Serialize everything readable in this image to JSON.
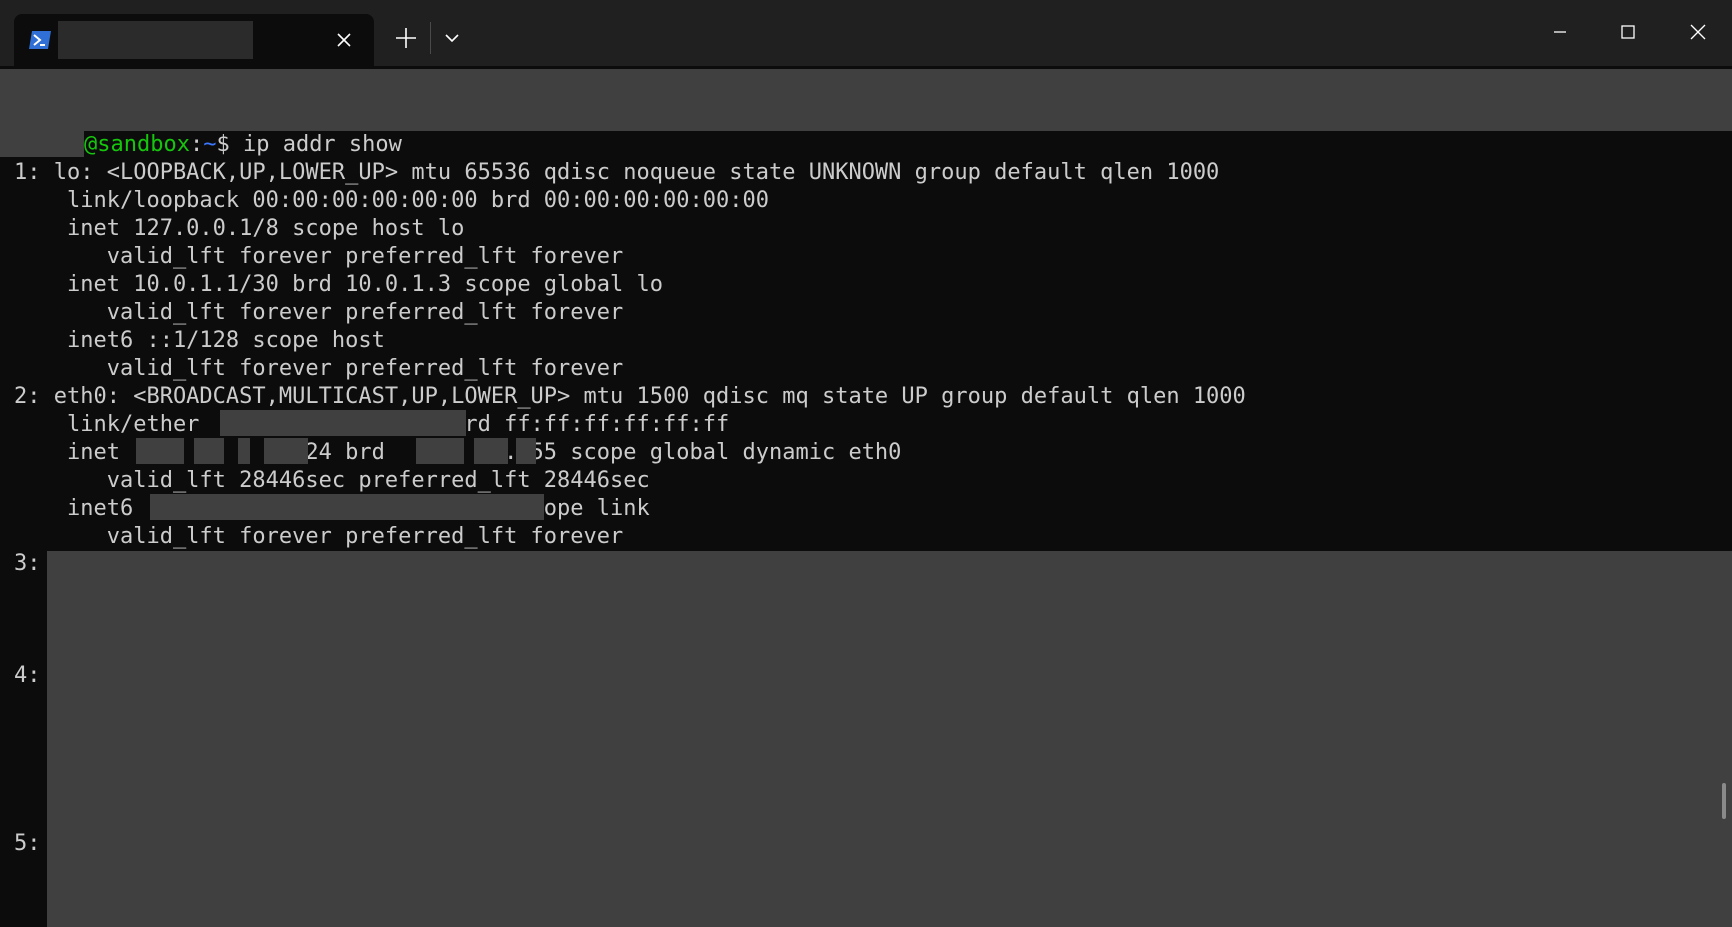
{
  "tab": {
    "title": ""
  },
  "prompt": {
    "user": "@sandbox",
    "colon": ":",
    "path": "~",
    "symbol": "$",
    "command": " ip addr show"
  },
  "output": {
    "lines": [
      "1: lo: <LOOPBACK,UP,LOWER_UP> mtu 65536 qdisc noqueue state UNKNOWN group default qlen 1000",
      "    link/loopback 00:00:00:00:00:00 brd 00:00:00:00:00:00",
      "    inet 127.0.0.1/8 scope host lo",
      "       valid_lft forever preferred_lft forever",
      "    inet 10.0.1.1/30 brd 10.0.1.3 scope global lo",
      "       valid_lft forever preferred_lft forever",
      "    inet6 ::1/128 scope host",
      "       valid_lft forever preferred_lft forever",
      "2: eth0: <BROADCAST,MULTICAST,UP,LOWER_UP> mtu 1500 qdisc mq state UP group default qlen 1000",
      "    link/ether                   brd ff:ff:ff:ff:ff:ff",
      "    inet    .  . .   /24 brd    .  . .255 scope global dynamic eth0",
      "       valid_lft 28446sec preferred_lft 28446sec",
      "    inet6                             scope link",
      "       valid_lft forever preferred_lft forever"
    ],
    "numbers": [
      "3:",
      "4:",
      "5:"
    ]
  },
  "colors": {
    "background": "#0c0c0c",
    "text": "#cccccc",
    "prompt_user": "#16c60c",
    "prompt_path": "#3b78ff",
    "redaction": "#404040"
  },
  "icons": {
    "tab_icon": "powershell-icon",
    "close": "close-icon",
    "new_tab": "plus-icon",
    "dropdown": "chevron-down-icon",
    "minimize": "minimize-icon",
    "maximize": "maximize-icon",
    "window_close": "close-icon"
  }
}
